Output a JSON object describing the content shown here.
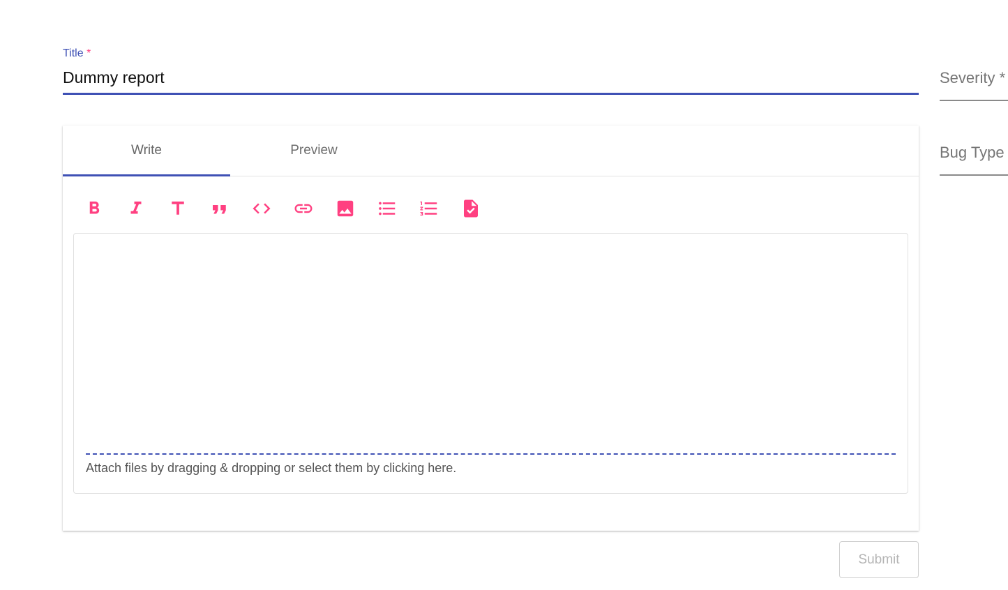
{
  "title_field": {
    "label": "Title",
    "required_mark": "*",
    "value": "Dummy report"
  },
  "severity_field": {
    "label": "Severity *"
  },
  "bug_type_field": {
    "label": "Bug Type"
  },
  "editor": {
    "tabs": [
      {
        "label": "Write",
        "active": true
      },
      {
        "label": "Preview",
        "active": false
      }
    ],
    "toolbar": [
      {
        "icon": "bold-icon"
      },
      {
        "icon": "italic-icon"
      },
      {
        "icon": "header-icon"
      },
      {
        "icon": "quote-icon"
      },
      {
        "icon": "code-icon"
      },
      {
        "icon": "link-icon"
      },
      {
        "icon": "image-icon"
      },
      {
        "icon": "unordered-list-icon"
      },
      {
        "icon": "ordered-list-icon"
      },
      {
        "icon": "checklist-file-icon"
      }
    ],
    "textarea_value": "",
    "attach_text": "Attach files by dragging & dropping or select them by clicking here."
  },
  "submit": {
    "label": "Submit",
    "disabled": true
  },
  "colors": {
    "primary": "#3f51b5",
    "accent": "#ff4081",
    "muted_text": "#757575"
  }
}
